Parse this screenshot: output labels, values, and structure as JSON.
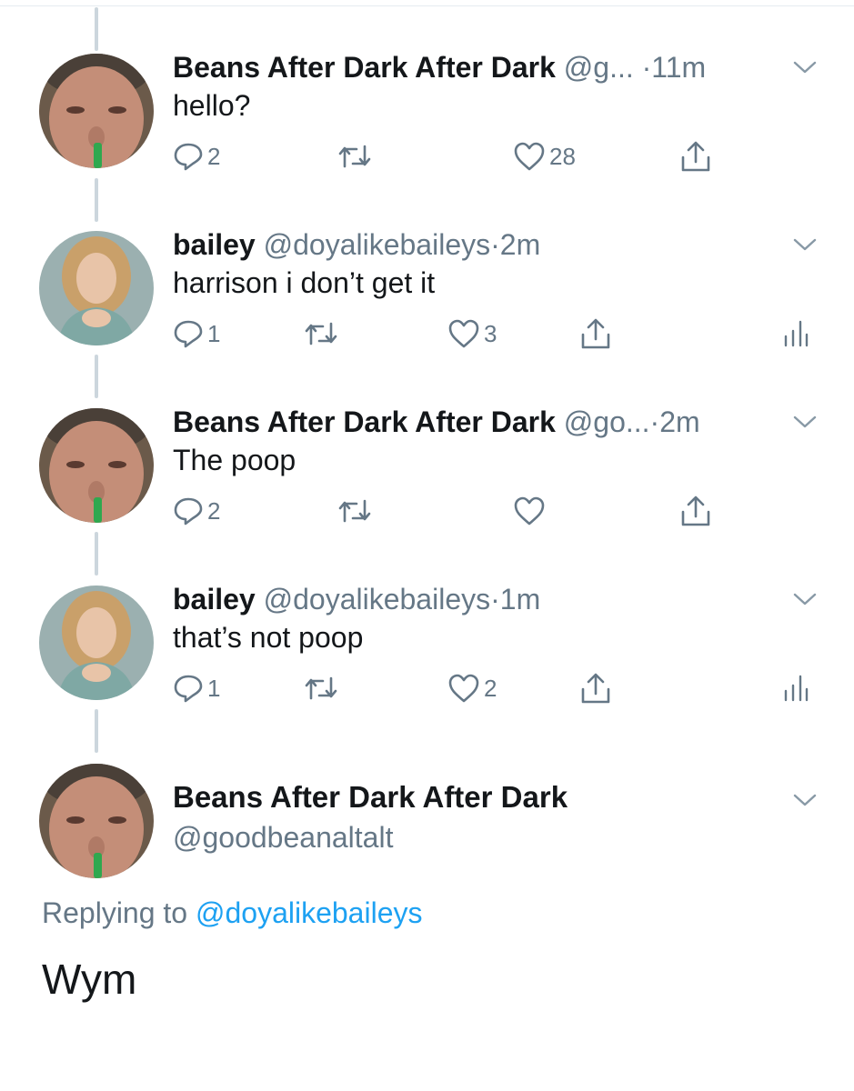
{
  "tweets": [
    {
      "name": "Beans After Dark After Dark",
      "handle": "@g...",
      "time": "11m",
      "text": "hello?",
      "replies": "2",
      "retweets": "",
      "likes": "28",
      "avatar": "beans",
      "analytics": false
    },
    {
      "name": "bailey",
      "handle": "@doyalikebaileys",
      "time": "2m",
      "text": "harrison i don’t get it",
      "replies": "1",
      "retweets": "",
      "likes": "3",
      "avatar": "bailey",
      "analytics": true
    },
    {
      "name": "Beans After Dark After Dark",
      "handle": "@go...",
      "time": "2m",
      "text": "The poop",
      "replies": "2",
      "retweets": "",
      "likes": "",
      "avatar": "beans",
      "analytics": false
    },
    {
      "name": "bailey",
      "handle": "@doyalikebaileys",
      "time": "1m",
      "text": "that’s not poop",
      "replies": "1",
      "retweets": "",
      "likes": "2",
      "avatar": "bailey",
      "analytics": true
    }
  ],
  "main_tweet": {
    "name": "Beans After Dark After Dark",
    "handle": "@goodbeanaltalt",
    "replying_prefix": "Replying to",
    "replying_to": "@doyalikebaileys",
    "text": "Wym"
  },
  "colors": {
    "accent": "#1da1f2",
    "muted": "#657786",
    "text": "#14171a",
    "thread": "#ccd6dd"
  },
  "icons": {
    "reply": "reply-icon",
    "retweet": "retweet-icon",
    "like": "heart-icon",
    "share": "share-icon",
    "analytics": "analytics-icon",
    "caret": "chevron-down-icon"
  }
}
